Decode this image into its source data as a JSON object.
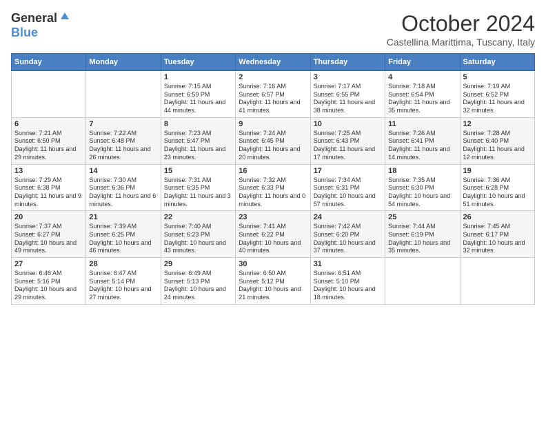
{
  "logo": {
    "general": "General",
    "blue": "Blue"
  },
  "title": "October 2024",
  "location": "Castellina Marittima, Tuscany, Italy",
  "days": [
    "Sunday",
    "Monday",
    "Tuesday",
    "Wednesday",
    "Thursday",
    "Friday",
    "Saturday"
  ],
  "weeks": [
    [
      {
        "date": "",
        "sunrise": "",
        "sunset": "",
        "daylight": ""
      },
      {
        "date": "",
        "sunrise": "",
        "sunset": "",
        "daylight": ""
      },
      {
        "date": "1",
        "sunrise": "Sunrise: 7:15 AM",
        "sunset": "Sunset: 6:59 PM",
        "daylight": "Daylight: 11 hours and 44 minutes."
      },
      {
        "date": "2",
        "sunrise": "Sunrise: 7:16 AM",
        "sunset": "Sunset: 6:57 PM",
        "daylight": "Daylight: 11 hours and 41 minutes."
      },
      {
        "date": "3",
        "sunrise": "Sunrise: 7:17 AM",
        "sunset": "Sunset: 6:55 PM",
        "daylight": "Daylight: 11 hours and 38 minutes."
      },
      {
        "date": "4",
        "sunrise": "Sunrise: 7:18 AM",
        "sunset": "Sunset: 6:54 PM",
        "daylight": "Daylight: 11 hours and 35 minutes."
      },
      {
        "date": "5",
        "sunrise": "Sunrise: 7:19 AM",
        "sunset": "Sunset: 6:52 PM",
        "daylight": "Daylight: 11 hours and 32 minutes."
      }
    ],
    [
      {
        "date": "6",
        "sunrise": "Sunrise: 7:21 AM",
        "sunset": "Sunset: 6:50 PM",
        "daylight": "Daylight: 11 hours and 29 minutes."
      },
      {
        "date": "7",
        "sunrise": "Sunrise: 7:22 AM",
        "sunset": "Sunset: 6:48 PM",
        "daylight": "Daylight: 11 hours and 26 minutes."
      },
      {
        "date": "8",
        "sunrise": "Sunrise: 7:23 AM",
        "sunset": "Sunset: 6:47 PM",
        "daylight": "Daylight: 11 hours and 23 minutes."
      },
      {
        "date": "9",
        "sunrise": "Sunrise: 7:24 AM",
        "sunset": "Sunset: 6:45 PM",
        "daylight": "Daylight: 11 hours and 20 minutes."
      },
      {
        "date": "10",
        "sunrise": "Sunrise: 7:25 AM",
        "sunset": "Sunset: 6:43 PM",
        "daylight": "Daylight: 11 hours and 17 minutes."
      },
      {
        "date": "11",
        "sunrise": "Sunrise: 7:26 AM",
        "sunset": "Sunset: 6:41 PM",
        "daylight": "Daylight: 11 hours and 14 minutes."
      },
      {
        "date": "12",
        "sunrise": "Sunrise: 7:28 AM",
        "sunset": "Sunset: 6:40 PM",
        "daylight": "Daylight: 11 hours and 12 minutes."
      }
    ],
    [
      {
        "date": "13",
        "sunrise": "Sunrise: 7:29 AM",
        "sunset": "Sunset: 6:38 PM",
        "daylight": "Daylight: 11 hours and 9 minutes."
      },
      {
        "date": "14",
        "sunrise": "Sunrise: 7:30 AM",
        "sunset": "Sunset: 6:36 PM",
        "daylight": "Daylight: 11 hours and 6 minutes."
      },
      {
        "date": "15",
        "sunrise": "Sunrise: 7:31 AM",
        "sunset": "Sunset: 6:35 PM",
        "daylight": "Daylight: 11 hours and 3 minutes."
      },
      {
        "date": "16",
        "sunrise": "Sunrise: 7:32 AM",
        "sunset": "Sunset: 6:33 PM",
        "daylight": "Daylight: 11 hours and 0 minutes."
      },
      {
        "date": "17",
        "sunrise": "Sunrise: 7:34 AM",
        "sunset": "Sunset: 6:31 PM",
        "daylight": "Daylight: 10 hours and 57 minutes."
      },
      {
        "date": "18",
        "sunrise": "Sunrise: 7:35 AM",
        "sunset": "Sunset: 6:30 PM",
        "daylight": "Daylight: 10 hours and 54 minutes."
      },
      {
        "date": "19",
        "sunrise": "Sunrise: 7:36 AM",
        "sunset": "Sunset: 6:28 PM",
        "daylight": "Daylight: 10 hours and 51 minutes."
      }
    ],
    [
      {
        "date": "20",
        "sunrise": "Sunrise: 7:37 AM",
        "sunset": "Sunset: 6:27 PM",
        "daylight": "Daylight: 10 hours and 49 minutes."
      },
      {
        "date": "21",
        "sunrise": "Sunrise: 7:39 AM",
        "sunset": "Sunset: 6:25 PM",
        "daylight": "Daylight: 10 hours and 46 minutes."
      },
      {
        "date": "22",
        "sunrise": "Sunrise: 7:40 AM",
        "sunset": "Sunset: 6:23 PM",
        "daylight": "Daylight: 10 hours and 43 minutes."
      },
      {
        "date": "23",
        "sunrise": "Sunrise: 7:41 AM",
        "sunset": "Sunset: 6:22 PM",
        "daylight": "Daylight: 10 hours and 40 minutes."
      },
      {
        "date": "24",
        "sunrise": "Sunrise: 7:42 AM",
        "sunset": "Sunset: 6:20 PM",
        "daylight": "Daylight: 10 hours and 37 minutes."
      },
      {
        "date": "25",
        "sunrise": "Sunrise: 7:44 AM",
        "sunset": "Sunset: 6:19 PM",
        "daylight": "Daylight: 10 hours and 35 minutes."
      },
      {
        "date": "26",
        "sunrise": "Sunrise: 7:45 AM",
        "sunset": "Sunset: 6:17 PM",
        "daylight": "Daylight: 10 hours and 32 minutes."
      }
    ],
    [
      {
        "date": "27",
        "sunrise": "Sunrise: 6:46 AM",
        "sunset": "Sunset: 5:16 PM",
        "daylight": "Daylight: 10 hours and 29 minutes."
      },
      {
        "date": "28",
        "sunrise": "Sunrise: 6:47 AM",
        "sunset": "Sunset: 5:14 PM",
        "daylight": "Daylight: 10 hours and 27 minutes."
      },
      {
        "date": "29",
        "sunrise": "Sunrise: 6:49 AM",
        "sunset": "Sunset: 5:13 PM",
        "daylight": "Daylight: 10 hours and 24 minutes."
      },
      {
        "date": "30",
        "sunrise": "Sunrise: 6:50 AM",
        "sunset": "Sunset: 5:12 PM",
        "daylight": "Daylight: 10 hours and 21 minutes."
      },
      {
        "date": "31",
        "sunrise": "Sunrise: 6:51 AM",
        "sunset": "Sunset: 5:10 PM",
        "daylight": "Daylight: 10 hours and 18 minutes."
      },
      {
        "date": "",
        "sunrise": "",
        "sunset": "",
        "daylight": ""
      },
      {
        "date": "",
        "sunrise": "",
        "sunset": "",
        "daylight": ""
      }
    ]
  ]
}
